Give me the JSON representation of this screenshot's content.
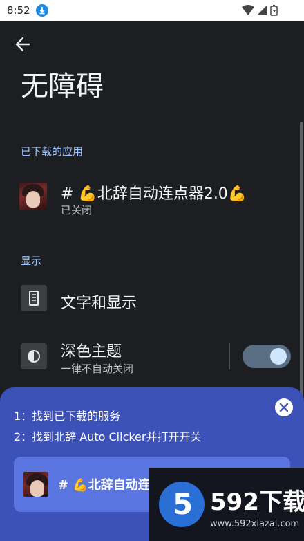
{
  "status_bar": {
    "time": "8:52"
  },
  "header": {
    "title": "无障碍"
  },
  "downloaded_section": {
    "header": "已下载的应用",
    "app": {
      "name": "# 💪北辞自动连点器2.0💪",
      "status": "已关闭"
    }
  },
  "display_section": {
    "header": "显示",
    "items": [
      {
        "title": "文字和显示"
      },
      {
        "title": "深色主题",
        "subtitle": "一律不自动关闭",
        "toggle_on": true
      }
    ]
  },
  "overlay": {
    "steps": [
      "1：找到已下载的服务",
      "2：找到北辞 Auto Clicker并打开开关"
    ],
    "card_label": "# 💪北辞自动连"
  },
  "watermark": {
    "brand": "592下载",
    "url": "www.592xiazai.com",
    "digit": "5"
  },
  "colors": {
    "accent": "#9fc3ff",
    "overlay": "#3d52b8",
    "card": "#5b75e0",
    "background": "#1c1e22"
  }
}
